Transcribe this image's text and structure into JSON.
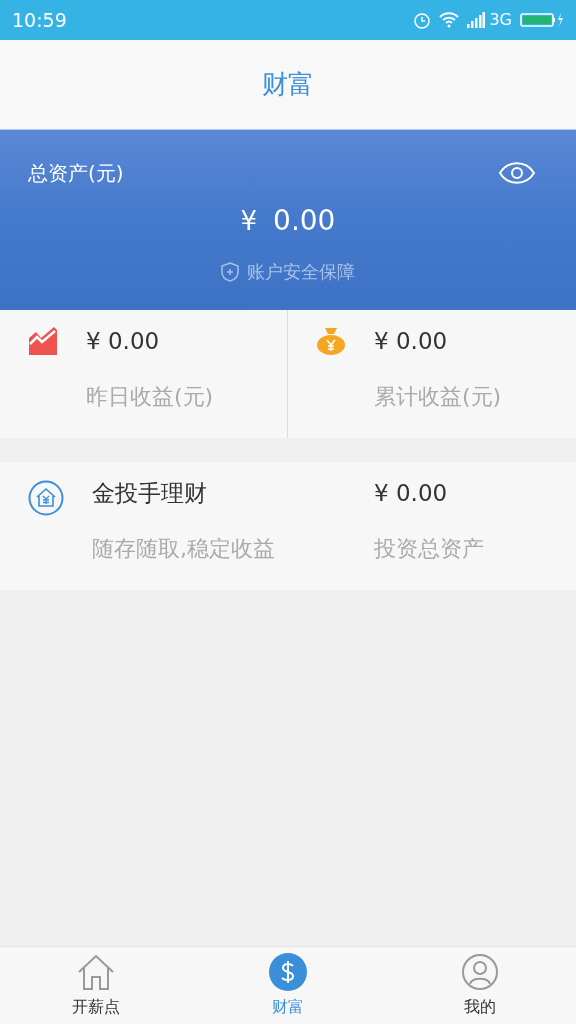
{
  "status_bar": {
    "time": "10:59",
    "network": "3G"
  },
  "header": {
    "title": "财富"
  },
  "total_card": {
    "label": "总资产(元)",
    "currency": "¥",
    "amount": "0.00",
    "security": "账户安全保障"
  },
  "stats": [
    {
      "kind": "chart",
      "amount": "¥ 0.00",
      "label": "昨日收益(元)"
    },
    {
      "kind": "bag",
      "amount": "¥ 0.00",
      "label": "累计收益(元)"
    }
  ],
  "product": {
    "name": "金投手理财",
    "amount": "¥ 0.00",
    "description": "随存随取,稳定收益",
    "amount_label": "投资总资产"
  },
  "tabs": [
    {
      "kind": "home",
      "label": "开薪点",
      "selected": false
    },
    {
      "kind": "wealth",
      "label": "财富",
      "selected": true
    },
    {
      "kind": "me",
      "label": "我的",
      "selected": false
    }
  ]
}
